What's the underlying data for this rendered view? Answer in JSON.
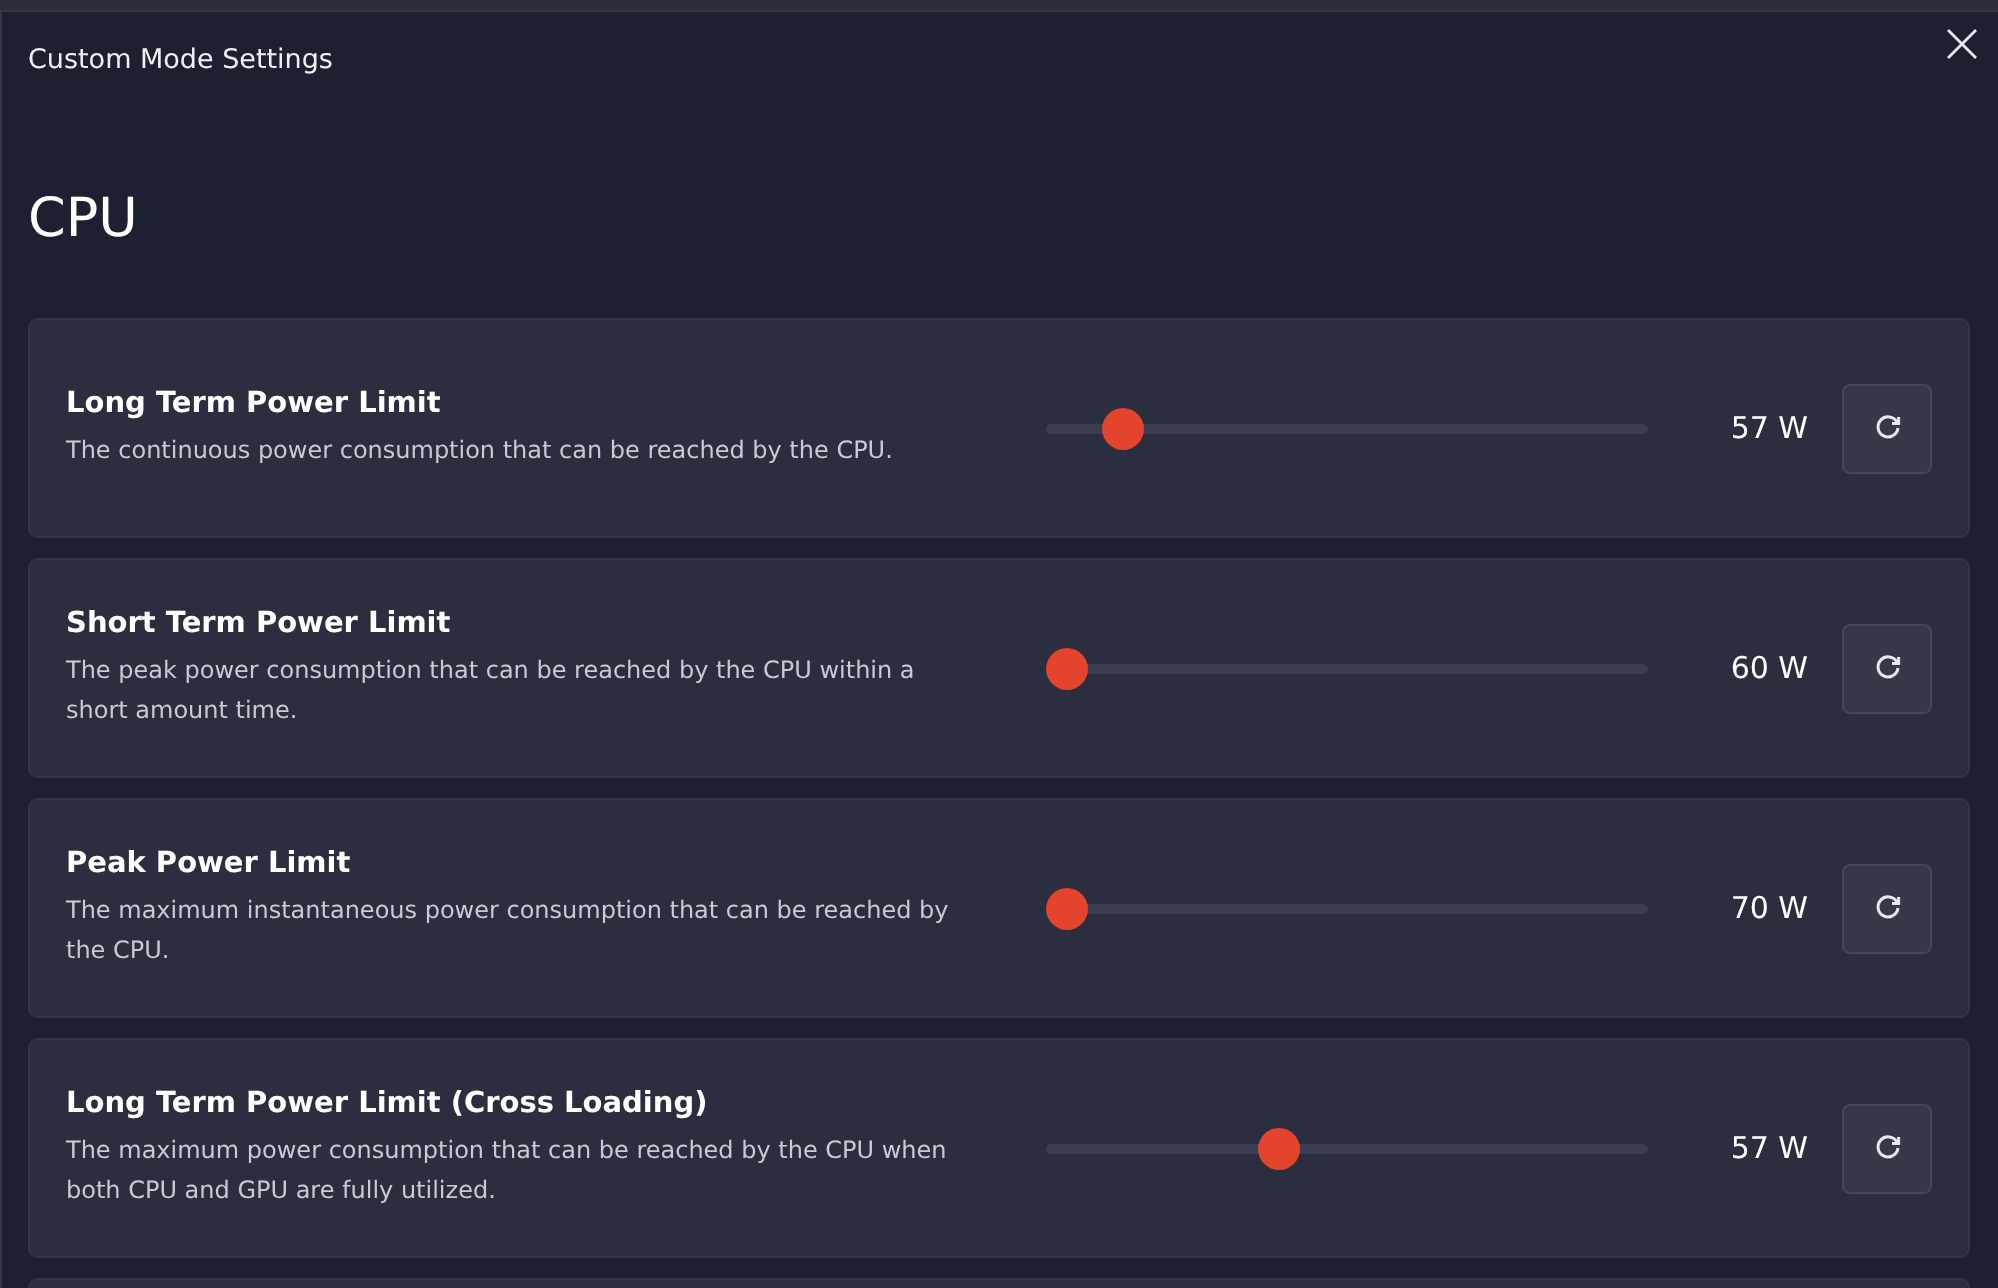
{
  "dialog": {
    "title": "Custom Mode Settings"
  },
  "section": {
    "heading": "CPU"
  },
  "settings": [
    {
      "title": "Long Term Power Limit",
      "description": "The continuous power consumption that can be reached by the CPU.",
      "level": 0.1,
      "reading": "57 W"
    },
    {
      "title": "Short Term Power Limit",
      "description": "The peak power consumption that can be reached by the CPU within a short amount time.",
      "level": 0,
      "reading": "60 W"
    },
    {
      "title": "Peak Power Limit",
      "description": "The maximum instantaneous power consumption that can be reached by the CPU.",
      "level": 0,
      "reading": "70 W"
    },
    {
      "title": "Long Term Power Limit (Cross Loading)",
      "description": "The maximum power consumption that can be reached by the CPU when both CPU and GPU are fully utilized.",
      "level": 0.38,
      "reading": "57 W"
    }
  ]
}
